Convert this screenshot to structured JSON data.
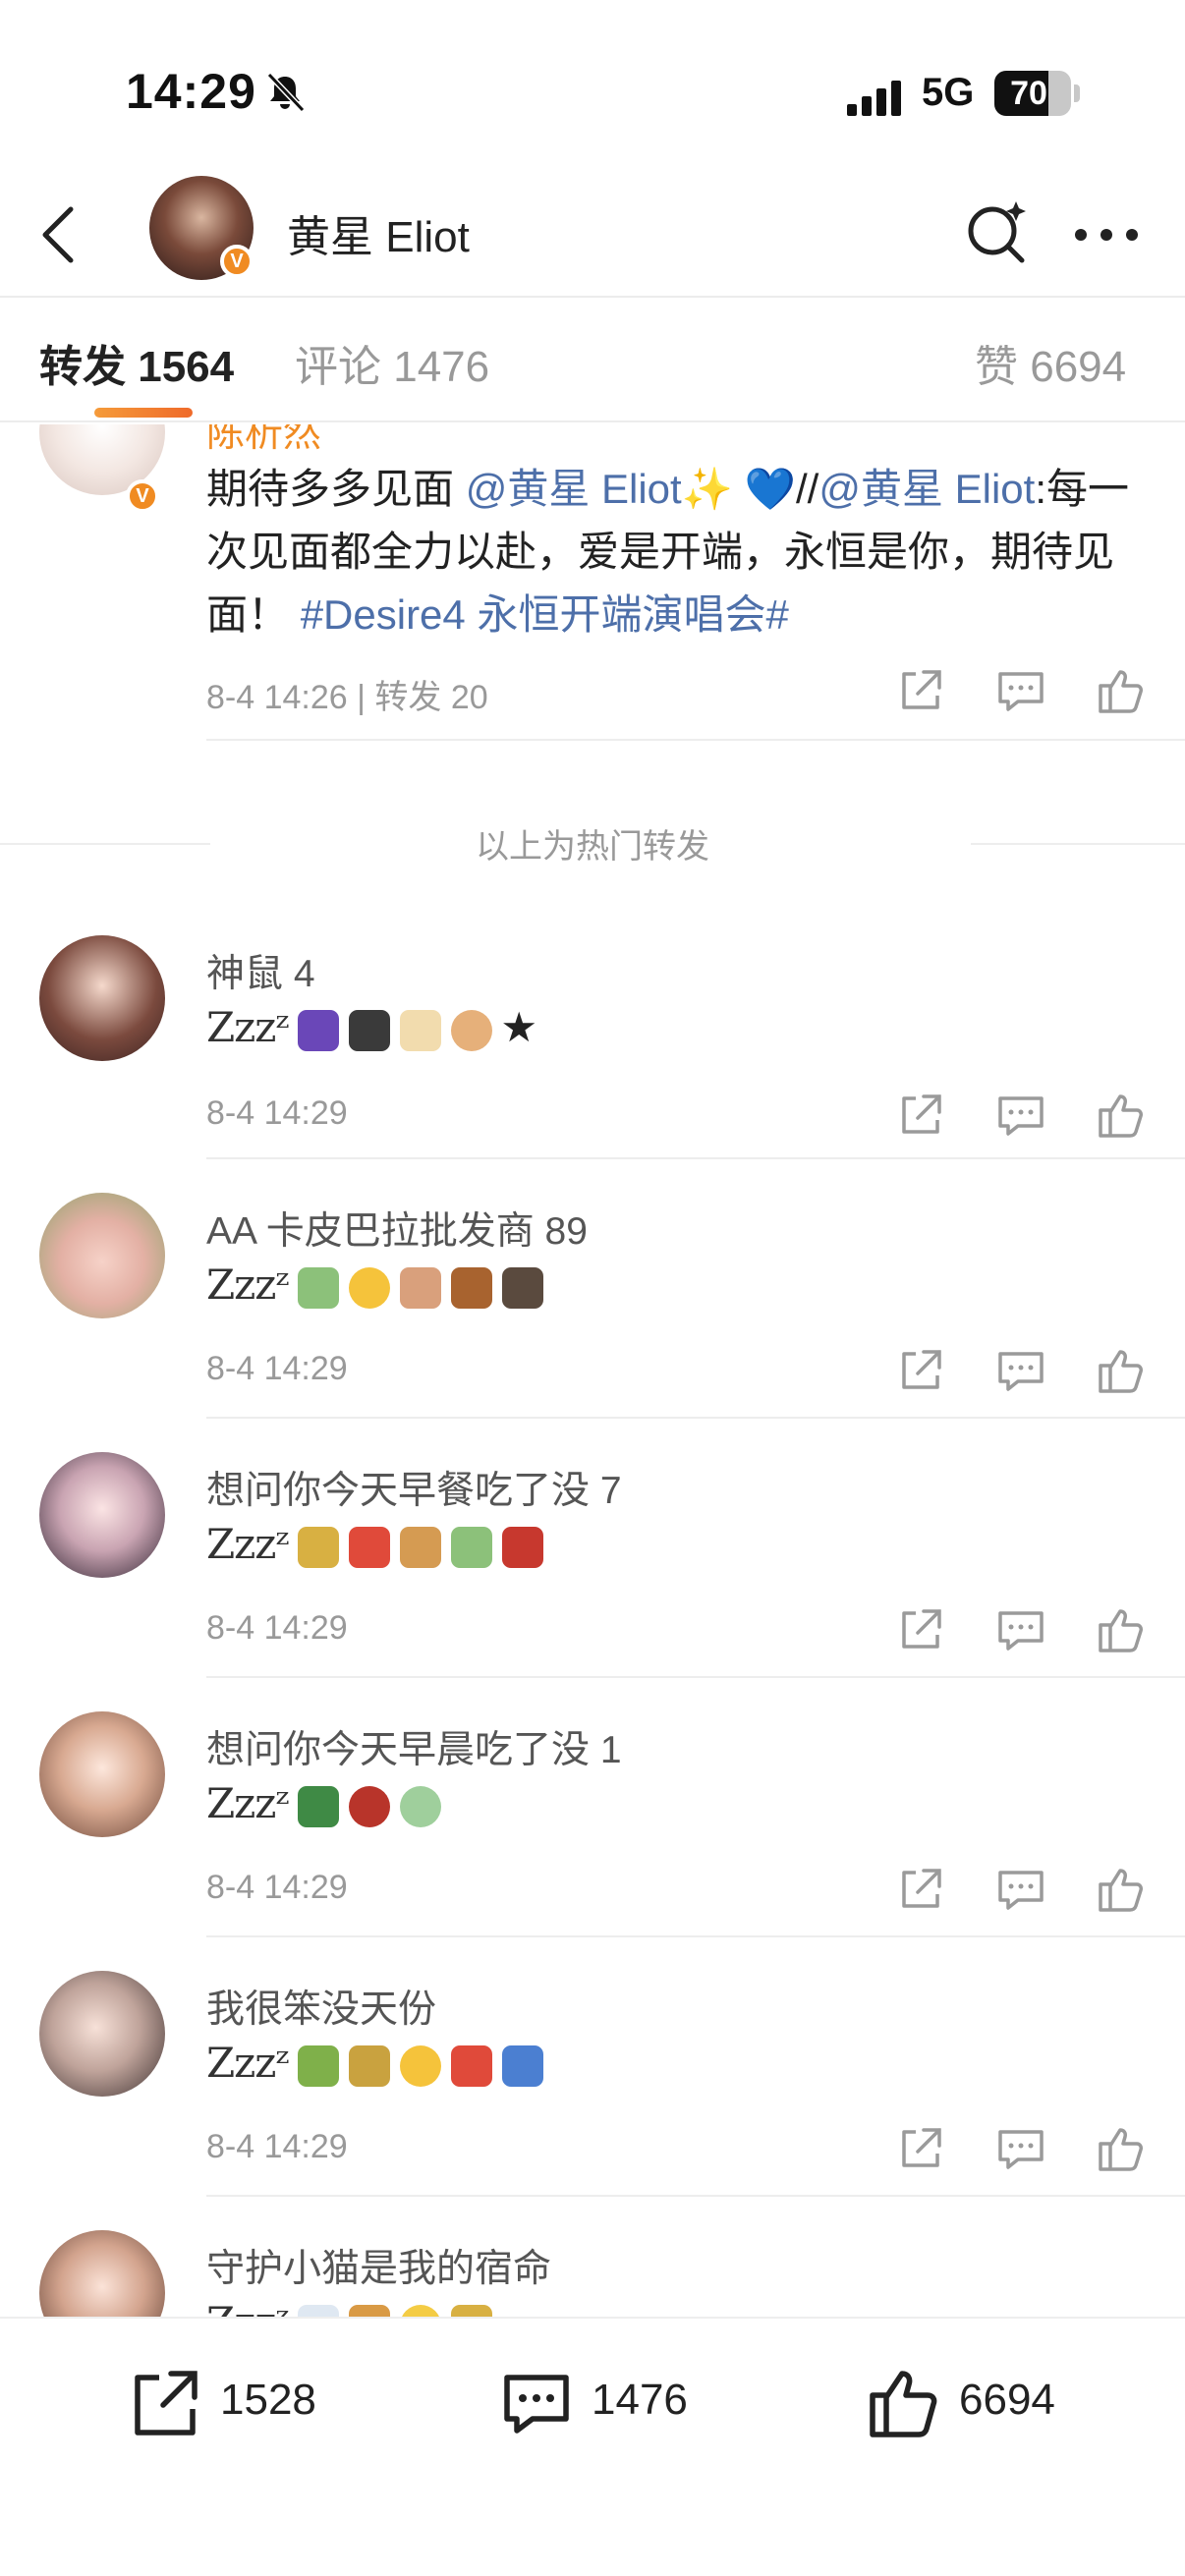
{
  "status_bar": {
    "time": "14:29",
    "network": "5G",
    "battery": "70",
    "battery_level": 0.7
  },
  "header": {
    "title": "黄星 Eliot",
    "verified": "V"
  },
  "tabs": [
    {
      "label": "转发 1564"
    },
    {
      "label": "评论 1476"
    },
    {
      "label": "赞 6694"
    }
  ],
  "top_post": {
    "user": "陈析然",
    "text_1": "期待多多见面",
    "mention_1": "@黄星 Eliot",
    "sparkle": "✨",
    "heart": "💙",
    "slashes": "//",
    "mention_2": "@黄星 Eliot",
    "text_2": ":每一次见面都全力以赴，爱是开端，永恒是你，期待见面！",
    "hashtag": "#Desire4 永恒开端演唱会#",
    "meta": "8-4 14:26 | 转发 20"
  },
  "hot_separator": "以上为热门转发",
  "reposts": [
    {
      "user": "神鼠 4",
      "zz": "Zzzᶻ",
      "emojis": [
        "👾",
        "🖥️",
        "🍦",
        "🍜",
        "★"
      ],
      "time": "8-4 14:29"
    },
    {
      "user": "AA 卡皮巴拉批发商 89",
      "zz": "Zzzᶻ",
      "emojis": [
        "💸",
        "🔆",
        "🏃",
        "🐿️",
        "📺"
      ],
      "time": "8-4 14:29"
    },
    {
      "user": "想问你今天早餐吃了没 7",
      "zz": "Zzzᶻ",
      "emojis": [
        "🥫",
        "🥤",
        "🍞",
        "💸",
        "🧣"
      ],
      "time": "8-4 14:29"
    },
    {
      "user": "想问你今天早晨吃了没 1",
      "zz": "Zzzᶻ",
      "emojis": [
        "🌲",
        "🫕",
        "🧑"
      ],
      "time": "8-4 14:29"
    },
    {
      "user": "我很笨没天份",
      "zz": "Zzzᶻ",
      "emojis": [
        "🎋",
        "🎍",
        "☀️",
        "🥤",
        "🚏"
      ],
      "time": "8-4 14:29"
    },
    {
      "user": "守护小猫是我的宿命",
      "zz": "Zzzᶻ",
      "emojis": [
        "☁️",
        "🌮",
        "🌟",
        "🥫"
      ],
      "time": ""
    }
  ],
  "bottom_bar": {
    "repost_count": "1528",
    "comment_count": "1476",
    "like_count": "6694"
  },
  "colors": {
    "accent": "#f08b22",
    "link": "#4d6fa9",
    "muted": "#999999"
  }
}
